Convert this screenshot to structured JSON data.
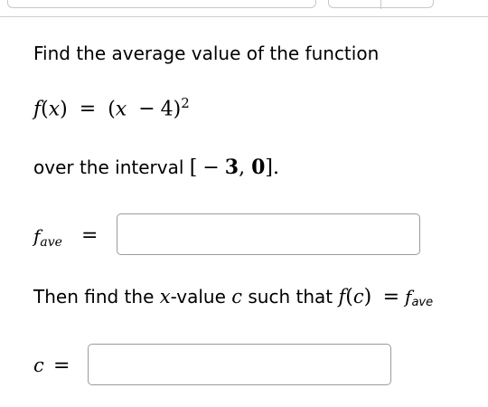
{
  "question": {
    "intro": "Find the average value of the function",
    "function": {
      "name": "f",
      "variable": "x",
      "equals": "=",
      "open_paren": "(",
      "minus": "−",
      "constant": "4",
      "close_paren": ")",
      "exponent": "2"
    },
    "interval_prefix": "over the interval",
    "interval": {
      "open": "[",
      "minus": "−",
      "start": "3",
      "comma": ",",
      "end": "0",
      "close": "]",
      "period": "."
    }
  },
  "fave_answer": {
    "label_base": "f",
    "label_sub": "ave",
    "equals": "=",
    "value": ""
  },
  "followup": {
    "text_1": "Then find the",
    "var_x": "x",
    "text_2": "-value",
    "var_c": "c",
    "text_3": "such that",
    "f_name": "f",
    "open_paren": "(",
    "c_arg": "c",
    "close_paren": ")",
    "equals": "=",
    "fave_base": "f",
    "fave_sub": "ave"
  },
  "c_answer": {
    "label": "c",
    "equals": "=",
    "value": ""
  }
}
